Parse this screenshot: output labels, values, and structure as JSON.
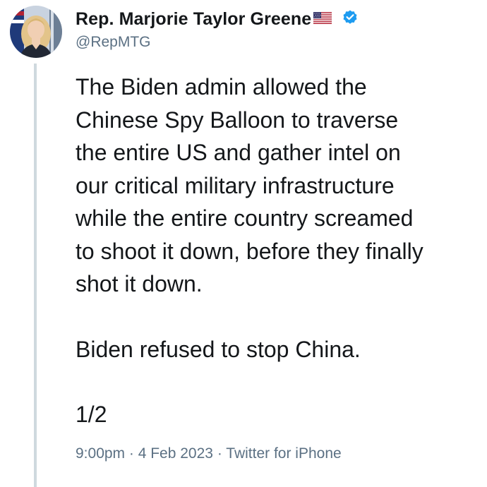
{
  "author": {
    "display_name": "Rep. Marjorie Taylor Greene",
    "handle": "@RepMTG",
    "flag_icon": "us-flag-icon",
    "verified_icon": "verified-badge-icon"
  },
  "tweet": {
    "paragraph_1": "The Biden admin allowed the\nChinese Spy Balloon to traverse\nthe entire US and gather intel on\nour critical military infrastructure\nwhile the entire country screamed\nto shoot it down, before they finally\nshot it down.",
    "paragraph_2": "Biden refused to stop China.",
    "paragraph_3": "1/2"
  },
  "meta": {
    "time": "9:00pm",
    "separator_1": " · ",
    "date": "4 Feb 2023",
    "separator_2": " · ",
    "source": "Twitter for iPhone"
  },
  "colors": {
    "text": "#14171a",
    "secondary_text": "#5b7083",
    "verified": "#1d9bf0",
    "thread_line": "#cfd9de"
  }
}
